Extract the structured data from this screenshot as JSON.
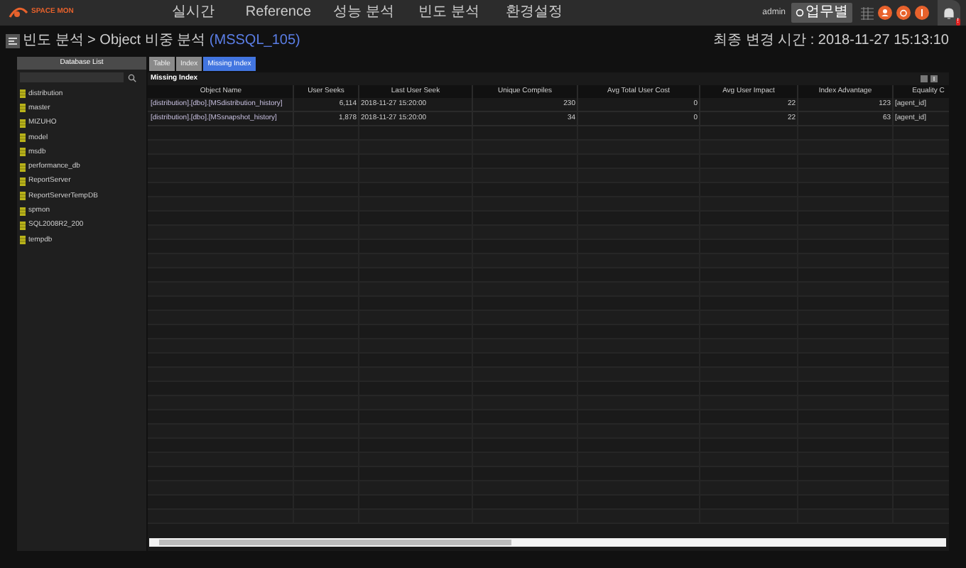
{
  "header": {
    "logo": "SPACE MON",
    "menu": [
      {
        "label": "실시간",
        "selected": false
      },
      {
        "label": "Reference",
        "selected": false
      },
      {
        "label": "성능 분석",
        "selected": false
      },
      {
        "label": "빈도 분석",
        "selected": false
      },
      {
        "label": "환경설정",
        "selected": false
      }
    ],
    "user": "admin",
    "mode_button": "업무별",
    "notification_badge": "!"
  },
  "breadcrumb": {
    "path": "빈도 분석 > Object 비중 분석",
    "instance": "(MSSQL_105)"
  },
  "last_updated": "최종 변경 시간 : 2018-11-27 15:13:10",
  "sidebar": {
    "title": "Database List",
    "items": [
      "distribution",
      "master",
      "MIZUHO",
      "model",
      "msdb",
      "performance_db",
      "ReportServer",
      "ReportServerTempDB",
      "spmon",
      "SQL2008R2_200",
      "tempdb"
    ]
  },
  "tabs": [
    {
      "label": "Table",
      "selected": false
    },
    {
      "label": "Index",
      "selected": false
    },
    {
      "label": "Missing Index",
      "selected": true
    }
  ],
  "panel_title": "Missing Index",
  "table": {
    "columns": [
      "Object Name",
      "User Seeks",
      "Last User Seek",
      "Unique Compiles",
      "Avg Total User Cost",
      "Avg User Impact",
      "Index Advantage",
      "Equality C"
    ],
    "rows": [
      [
        "[distribution].[dbo].[MSdistribution_history]",
        "6,114",
        "2018-11-27 15:20:00",
        "230",
        "0",
        "22",
        "123",
        "[agent_id]"
      ],
      [
        "[distribution].[dbo].[MSsnapshot_history]",
        "1,878",
        "2018-11-27 15:20:00",
        "34",
        "0",
        "22",
        "63",
        "[agent_id]"
      ]
    ]
  }
}
